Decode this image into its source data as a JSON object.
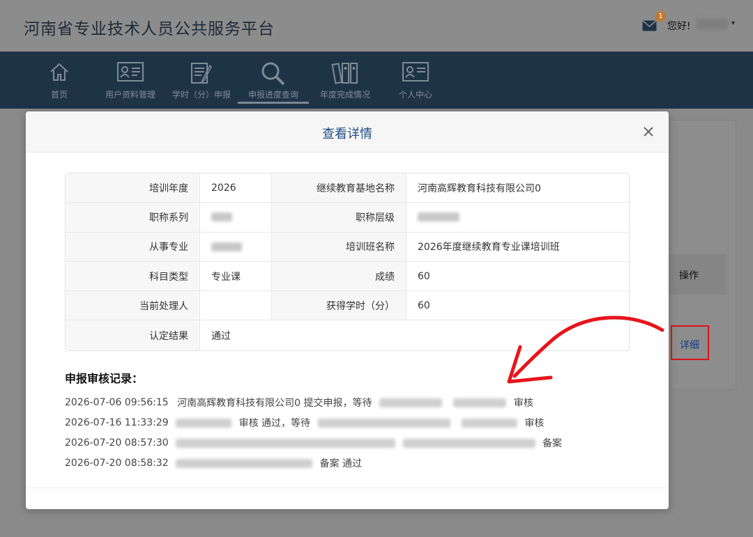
{
  "app": {
    "title": "河南省专业技术人员公共服务平台",
    "mail_badge": "1",
    "greeting": "您好!",
    "user_caret": "▾"
  },
  "nav": [
    {
      "label": "首页",
      "icon": "home-icon"
    },
    {
      "label": "用户资料管理",
      "icon": "user-card-icon"
    },
    {
      "label": "学时（分）申报",
      "icon": "document-pen-icon"
    },
    {
      "label": "申报进度查询",
      "icon": "magnifier-icon",
      "active": true
    },
    {
      "label": "年度完成情况",
      "icon": "binders-icon"
    },
    {
      "label": "个人中心",
      "icon": "profile-card-icon"
    }
  ],
  "table_bg": {
    "op_header": "操作",
    "detail_link": "详细"
  },
  "modal": {
    "title": "查看详情",
    "close_icon": "close-icon",
    "rows": [
      {
        "label1": "培训年度",
        "value1": "2026",
        "label2": "继续教育基地名称",
        "value2": "河南高辉教育科技有限公司0"
      },
      {
        "label1": "职称系列",
        "value1": "",
        "label2": "职称层级",
        "value2": ""
      },
      {
        "label1": "从事专业",
        "value1": "",
        "label2": "培训班名称",
        "value2": "2026年度继续教育专业课培训班"
      },
      {
        "label1": "科目类型",
        "value1": "专业课",
        "label2": "成绩",
        "value2": "60"
      },
      {
        "label1": "当前处理人",
        "value1": "",
        "label2": "获得学时（分）",
        "value2": "60"
      },
      {
        "label1": "认定结果",
        "value1": "通过"
      }
    ],
    "records_title": "申报审核记录：",
    "records": [
      {
        "time": "2026-07-06 09:56:15",
        "before": "河南高辉教育科技有限公司0 提交申报，等待",
        "after": "审核"
      },
      {
        "time": "2026-07-16 11:33:29",
        "before": "",
        "after": "审核 通过，等待",
        "tail": "审核"
      },
      {
        "time": "2026-07-20 08:57:30",
        "before": "",
        "after": "备案"
      },
      {
        "time": "2026-07-20 08:58:32",
        "before": "",
        "after": "备案 通过"
      }
    ]
  },
  "colors": {
    "nav_bg": "#1f3347",
    "modal_title": "#1f4f85",
    "highlight_box": "#d8141a",
    "arrow": "#e8141c"
  }
}
